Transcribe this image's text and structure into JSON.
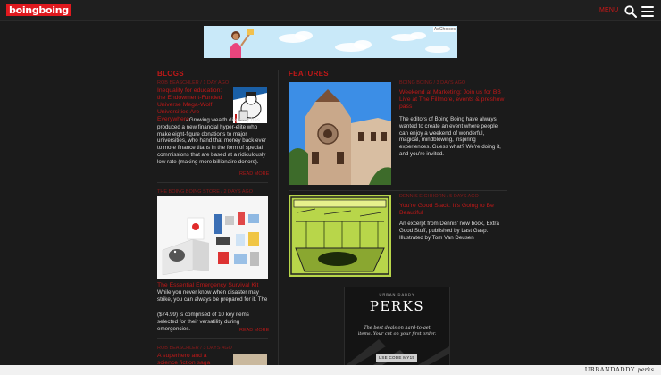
{
  "header": {
    "logo_text": "boingboing",
    "menu_label": "MENU",
    "colors": {
      "brand": "#e0191e",
      "background": "#1b1b1b"
    }
  },
  "banner_ad": {
    "adchoices_label": "AdChoices"
  },
  "blogs": {
    "title": "BLOGS",
    "items": [
      {
        "meta": "ROB BEASCHLER / 1 DAY AGO",
        "headline": "Inequality for education: the Endowment-Funded Universe Mega-Wolf Universities Are Everywhere",
        "body": "- Growing wealth disparity has produced a new financial hyper-elite who make eight-figure donations to major universities, who hand that money back ever to more finance titans in the form of special commissions that are based at a ridiculously low rate (making more billionaire donors).",
        "read_more": "READ MORE"
      },
      {
        "meta": "THE BOING BOING STORE / 2 DAYS AGO",
        "headline": "The Essential Emergency Survival Kit",
        "body_a": "While you never know when disaster may strike, you can always be prepared for it. The",
        "body_b": "($74.99) is comprised of 10 key items selected for their versatility during emergencies.",
        "read_more": "READ MORE"
      },
      {
        "meta": "ROB BEASCHLER / 3 DAYS AGO",
        "headline": "A superhero and a science fiction saga"
      }
    ]
  },
  "features": {
    "title": "FEATURES",
    "items": [
      {
        "meta": "BOING BOING / 3 DAYS AGO",
        "headline": "Weekend at Marketing: Join us for BB Live at The Fillmore, events & preshow pass",
        "body": "The editors of Boing Boing have always wanted to create an event where people can enjoy a weekend of wonderful, magical, mindblowing, inspiring experiences. Guess what? We're doing it, and you're invited."
      },
      {
        "meta": "DENNIS EICHHORN / 5 DAYS AGO",
        "headline": "You're Good Slack: It's Going to Be Beautiful",
        "body": "An excerpt from Dennis' new book, Extra Good Stuff, published by Last Gasp. Illustrated by Tom Van Deusen"
      }
    ]
  },
  "sidebar_ad": {
    "brand_small": "URBAN DADDY",
    "title": "PERKS",
    "tagline": "The best deals on hard-to-get items. Your cut on your first order.",
    "button": "USE CODE MY15"
  },
  "footer": {
    "brand": "URBANDADDY",
    "brand_suffix": "perks"
  }
}
